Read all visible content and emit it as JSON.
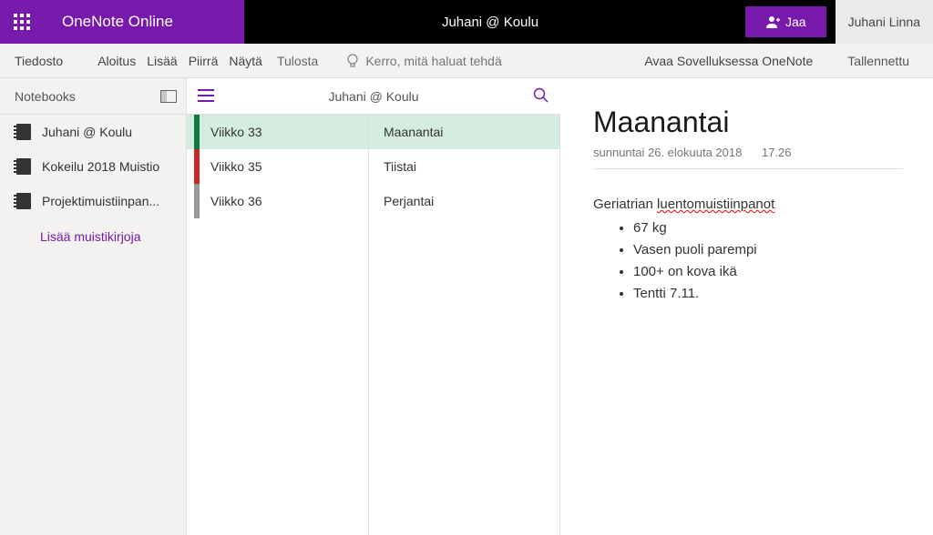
{
  "topbar": {
    "app_name": "OneNote Online",
    "doc_title": "Juhani @ Koulu",
    "share_label": "Jaa",
    "user_name": "Juhani Linna"
  },
  "ribbon": {
    "items": [
      "Tiedosto",
      "Aloitus",
      "Lisää",
      "Piirrä",
      "Näytä",
      "Tulosta"
    ],
    "tell_me_placeholder": "Kerro, mitä haluat tehdä",
    "open_desktop": "Avaa Sovelluksessa OneNote",
    "saved_status": "Tallennettu"
  },
  "notebooks": {
    "header": "Notebooks",
    "items": [
      {
        "label": "Juhani @ Koulu"
      },
      {
        "label": "Kokeilu 2018 Muistio"
      },
      {
        "label": "Projektimuistiinpan..."
      }
    ],
    "add_label": "Lisää muistikirjoja"
  },
  "mid_header_title": "Juhani @ Koulu",
  "sections": [
    {
      "label": "Viikko 33",
      "color": "#0f7a3c",
      "active": true
    },
    {
      "label": "Viikko 35",
      "color": "#c62828",
      "active": false
    },
    {
      "label": "Viikko 36",
      "color": "#999999",
      "active": false
    }
  ],
  "pages": [
    {
      "label": "Maanantai",
      "active": true
    },
    {
      "label": "Tiistai",
      "active": false
    },
    {
      "label": "Perjantai",
      "active": false
    }
  ],
  "content": {
    "title": "Maanantai",
    "date": "sunnuntai 26. elokuuta 2018",
    "time": "17.26",
    "heading_plain": "Geriatrian ",
    "heading_squiggle": "luentomuistiinpanot",
    "bullets": [
      "67 kg",
      "Vasen puoli parempi",
      "100+ on kova ikä",
      "Tentti 7.11."
    ]
  }
}
